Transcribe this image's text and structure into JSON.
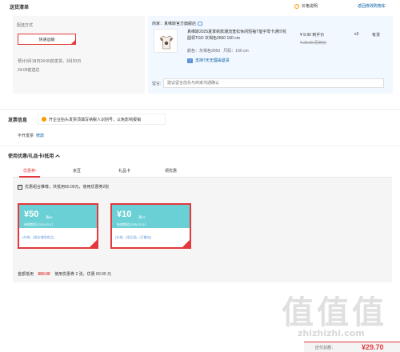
{
  "header": {
    "title": "送货清单",
    "price_note": "价格说明",
    "back_to_cart": "返回修改购物车"
  },
  "delivery": {
    "method_label": "配送方式",
    "method_value": "快递运输",
    "line1": "预计3月18日24:00前发货，3月20日",
    "line2": "24:00前送达"
  },
  "product": {
    "seller": "商家：真维斯官方旗舰店",
    "name": "真维斯2025夏季新款潮流宽松休闲短袖T恤字母卡通印花圆领TGD 灰褐色2650 160 cm",
    "color_label": "颜色：灰褐色2650",
    "size_label": "尺码：160 cm",
    "return_policy": "支持7天无理由退货",
    "return_icon": "7",
    "price": "¥ 9.90 到手价",
    "old_price": "¥ 29.90 原到价",
    "qty": "x3",
    "stock": "有货",
    "note_label": "留言:",
    "note_placeholder": "建议留言前先与商家沟通确认"
  },
  "invoice": {
    "title": "发票信息",
    "tip": "开企业抬头发票须填写纳税人识别号，以免影响报销",
    "value": "不开发票",
    "modify": "修改"
  },
  "coupons": {
    "title": "使用优惠/礼品卡/抵用",
    "tabs": [
      {
        "label": "优惠券",
        "active": true,
        "star": "•"
      },
      {
        "label": "京豆",
        "active": false
      },
      {
        "label": "礼品卡",
        "active": false
      },
      {
        "label": "领优惠",
        "active": false
      }
    ],
    "option_label": "优惠组合推荐，共抵用60.00元，使用优惠券2张",
    "option_check": "✓",
    "items": [
      {
        "amount": "¥50",
        "condition": "满69",
        "expiry": "有效期至2025-03-17",
        "tags": [
          "[东券]",
          "[限店铺限商品]"
        ]
      },
      {
        "amount": "¥10",
        "condition": "满79",
        "expiry": "有效期至2025-03-31",
        "tags": [
          "[东券]",
          "[限品类]",
          "[可叠加]"
        ]
      }
    ],
    "footer_label": "金额抵用",
    "footer_amount": "¥60.00",
    "footer_detail": "使用优惠券 2 张，优惠 60.00 元"
  },
  "payable": {
    "label": "应付总额：",
    "value": "¥29.70"
  },
  "watermark": {
    "chars": "值值值",
    "url": "zhizhizhi.com"
  },
  "colors": {
    "accent": "#e4393c",
    "coupon_teal": "#6bd0d6",
    "link_blue": "#005aa0",
    "product_bg": "#f1f8ff"
  }
}
